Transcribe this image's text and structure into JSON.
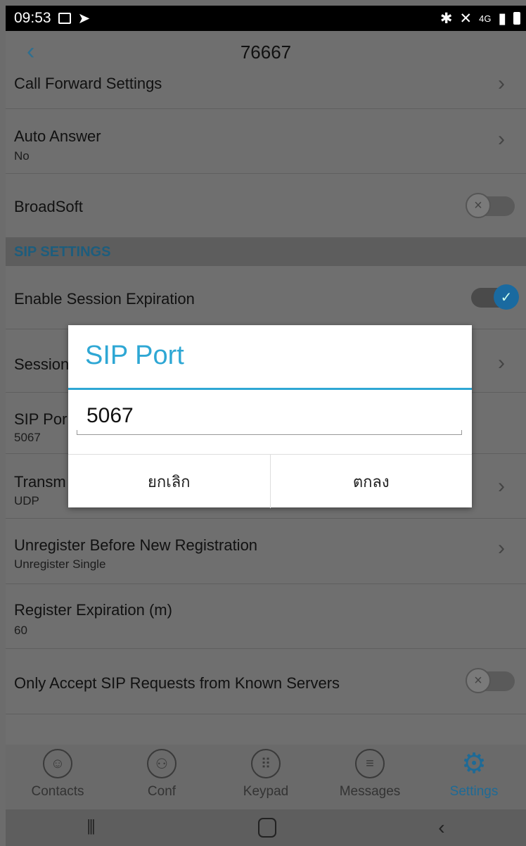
{
  "status_bar": {
    "time": "09:53",
    "network": "4G"
  },
  "header": {
    "title": "76667",
    "back_icon": "chevron-left-icon"
  },
  "rows": [
    {
      "title": "Call Forward Settings",
      "type": "chevron"
    },
    {
      "title": "Auto Answer",
      "sub": "No",
      "type": "chevron"
    },
    {
      "title": "BroadSoft",
      "type": "toggle",
      "state": "off"
    }
  ],
  "section_sip": "SIP SETTINGS",
  "sip_rows": [
    {
      "title": "Enable Session Expiration",
      "type": "toggle",
      "state": "on"
    },
    {
      "title": "Session",
      "type": "chevron"
    },
    {
      "title": "SIP Por",
      "sub": "5067"
    },
    {
      "title": "Transm",
      "sub": "UDP",
      "type": "chevron"
    },
    {
      "title": "Unregister Before New Registration",
      "sub": "Unregister Single",
      "type": "chevron"
    },
    {
      "title": "Register Expiration (m)",
      "sub": "60"
    },
    {
      "title": "Only Accept SIP Requests from Known Servers",
      "type": "toggle",
      "state": "off"
    }
  ],
  "bottom_nav": [
    {
      "label": "Contacts",
      "icon": "contacts-icon"
    },
    {
      "label": "Conf",
      "icon": "conference-icon"
    },
    {
      "label": "Keypad",
      "icon": "keypad-icon"
    },
    {
      "label": "Messages",
      "icon": "messages-icon"
    },
    {
      "label": "Settings",
      "icon": "gear-icon",
      "active": true
    }
  ],
  "dialog": {
    "title": "SIP Port",
    "value": "5067",
    "cancel_label": "ยกเลิก",
    "ok_label": "ตกลง"
  },
  "colors": {
    "accent": "#2ea7d4",
    "active_nav": "#1e6a96"
  }
}
